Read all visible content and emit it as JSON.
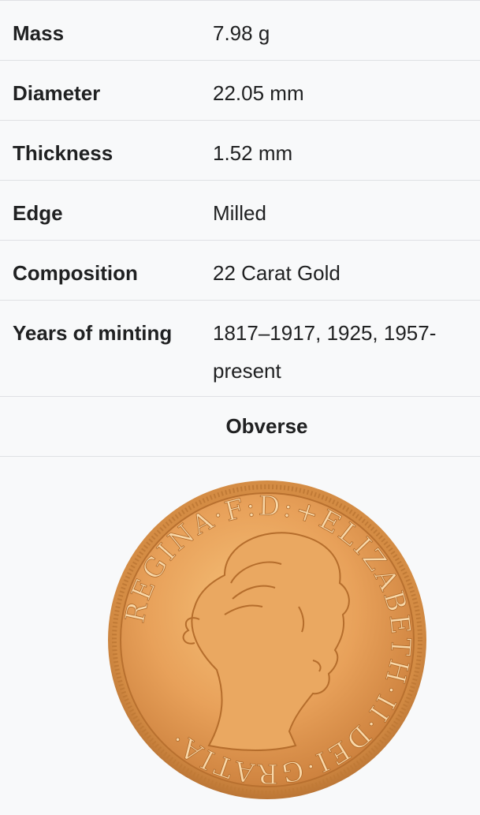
{
  "rows": [
    {
      "label": "Mass",
      "value": "7.98 g"
    },
    {
      "label": "Diameter",
      "value": "22.05 mm"
    },
    {
      "label": "Thickness",
      "value": "1.52 mm"
    },
    {
      "label": "Edge",
      "value": "Milled"
    },
    {
      "label": "Composition",
      "value": "22 Carat Gold"
    },
    {
      "label": "Years of minting",
      "value_line1": "1817–1917, 1925, 1957-",
      "value_line2": "present"
    }
  ],
  "section_header": "Obverse",
  "coin": {
    "inscription": "REGINA·F:D:+ELIZABETH·II·DEI·GRATIA·",
    "colors": {
      "gold_light": "#f2b868",
      "gold_mid": "#e49c50",
      "gold_dark": "#b86e2e"
    },
    "image": "gold-sovereign-obverse"
  }
}
